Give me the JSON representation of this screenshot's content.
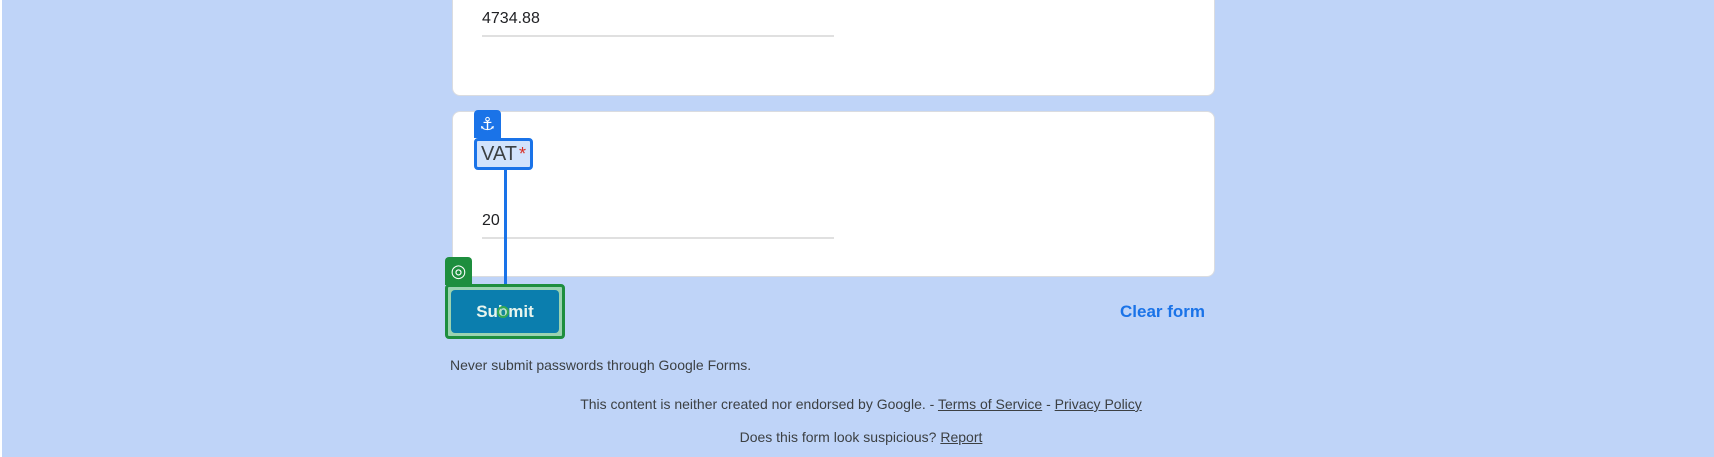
{
  "previous_question": {
    "answer_value": "4734.88"
  },
  "vat_question": {
    "title": "VAT",
    "required_marker": "*",
    "answer_value": "20"
  },
  "actions": {
    "submit_label": "Submit",
    "clear_label": "Clear form"
  },
  "notices": {
    "password_warning": "Never submit passwords through Google Forms.",
    "disclaimer": "This content is neither created nor endorsed by Google.",
    "separator": "-",
    "terms_label": "Terms of Service",
    "privacy_label": "Privacy Policy",
    "suspicious_question": "Does this form look suspicious?",
    "report_label": "Report"
  },
  "overlay": {
    "anchor_icon": "anchor-icon",
    "target_icon": "target-icon",
    "colors": {
      "anchor": "#1a73e8",
      "target": "#1e8e3e"
    }
  }
}
